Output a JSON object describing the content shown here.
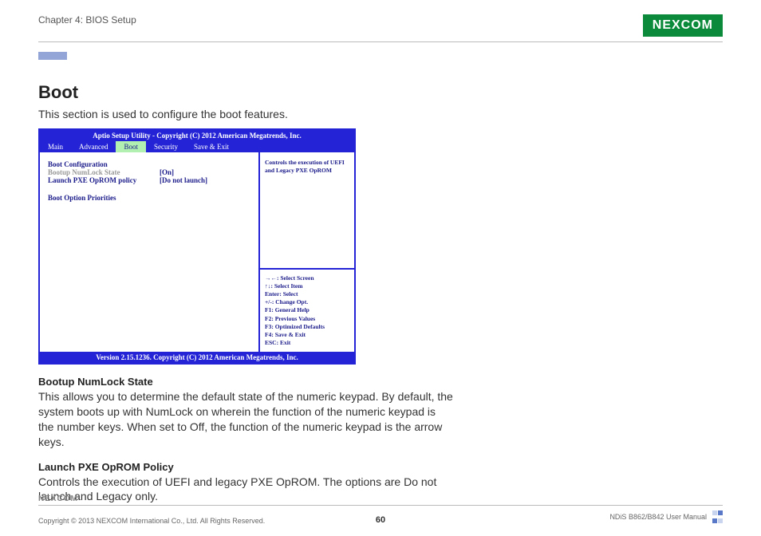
{
  "header": {
    "chapter": "Chapter 4: BIOS Setup",
    "logo": "NEXCOM"
  },
  "content": {
    "title": "Boot",
    "intro": "This section is used to configure the boot features."
  },
  "bios": {
    "utility_title": "Aptio Setup Utility - Copyright (C) 2012 American Megatrends, Inc.",
    "tabs": {
      "main": "Main",
      "advanced": "Advanced",
      "boot": "Boot",
      "security": "Security",
      "save_exit": "Save & Exit"
    },
    "left": {
      "boot_config": "Boot Configuration",
      "numlock_label": "Bootup NumLock State",
      "numlock_value": "[On]",
      "pxe_label": "Launch PXE OpROM policy",
      "pxe_value": "[Do not launch]",
      "priorities": "Boot Option Priorities"
    },
    "help": "Controls the execution of UEFI and Legacy PXE OpROM",
    "keys": {
      "k1": "→←: Select Screen",
      "k2": "↑↓: Select Item",
      "k3": "Enter: Select",
      "k4": "+/-: Change Opt.",
      "k5": "F1: General Help",
      "k6": "F2: Previous Values",
      "k7": "F3: Optimized Defaults",
      "k8": "F4: Save & Exit",
      "k9": "ESC: Exit"
    },
    "footer": "Version 2.15.1236. Copyright (C) 2012 American Megatrends, Inc."
  },
  "sections": {
    "numlock_heading": "Bootup NumLock State",
    "numlock_body": "This allows you to determine the default state of the numeric keypad. By default, the system boots up with NumLock on wherein the function of the numeric keypad is the number keys. When set to Off, the function of the numeric keypad is the arrow keys.",
    "pxe_heading": "Launch PXE OpROM Policy",
    "pxe_body": "Controls the execution of UEFI and legacy PXE OpROM. The options are Do not launch and Legacy only."
  },
  "footer": {
    "logo": "NEXCOM",
    "copyright": "Copyright © 2013 NEXCOM International Co., Ltd. All Rights Reserved.",
    "page": "60",
    "manual": "NDiS B862/B842 User Manual"
  }
}
